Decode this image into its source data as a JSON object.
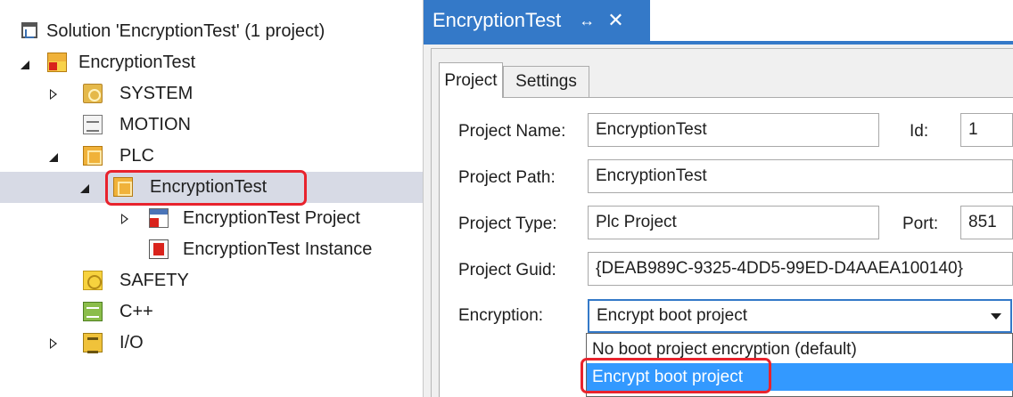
{
  "explorer": {
    "solution_label": "Solution 'EncryptionTest' (1 project)",
    "items": [
      {
        "label": "EncryptionTest",
        "icon": "twincat-project-icon"
      },
      {
        "label": "SYSTEM",
        "icon": "system-icon"
      },
      {
        "label": "MOTION",
        "icon": "motion-icon"
      },
      {
        "label": "PLC",
        "icon": "plc-icon"
      },
      {
        "label": "EncryptionTest",
        "icon": "plc-project-icon",
        "selected": true
      },
      {
        "label": "EncryptionTest Project",
        "icon": "plc-project-file-icon"
      },
      {
        "label": "EncryptionTest Instance",
        "icon": "plc-instance-icon"
      },
      {
        "label": "SAFETY",
        "icon": "safety-icon"
      },
      {
        "label": "C++",
        "icon": "cpp-icon"
      },
      {
        "label": "I/O",
        "icon": "io-icon"
      }
    ]
  },
  "document": {
    "tab_title": "EncryptionTest",
    "pin_glyph": "↔",
    "close_glyph": "✕"
  },
  "form": {
    "tabs": [
      "Project",
      "Settings"
    ],
    "project_name_label": "Project Name:",
    "project_name_value": "EncryptionTest",
    "id_label": "Id:",
    "id_value": "1",
    "project_path_label": "Project Path:",
    "project_path_value": "EncryptionTest",
    "project_type_label": "Project Type:",
    "project_type_value": "Plc Project",
    "port_label": "Port:",
    "port_value": "851",
    "project_guid_label": "Project Guid:",
    "project_guid_value": "{DEAB989C-9325-4DD5-99ED-D4AAEA100140}",
    "encryption_label": "Encryption:",
    "encryption_value": "Encrypt boot project",
    "encryption_options": [
      "No boot project encryption (default)",
      "Encrypt boot project"
    ]
  },
  "colors": {
    "accent": "#3479c8",
    "selection_highlight": "#3399ff",
    "annotation_red": "#e8232d",
    "tree_selection": "#d7dae5"
  }
}
